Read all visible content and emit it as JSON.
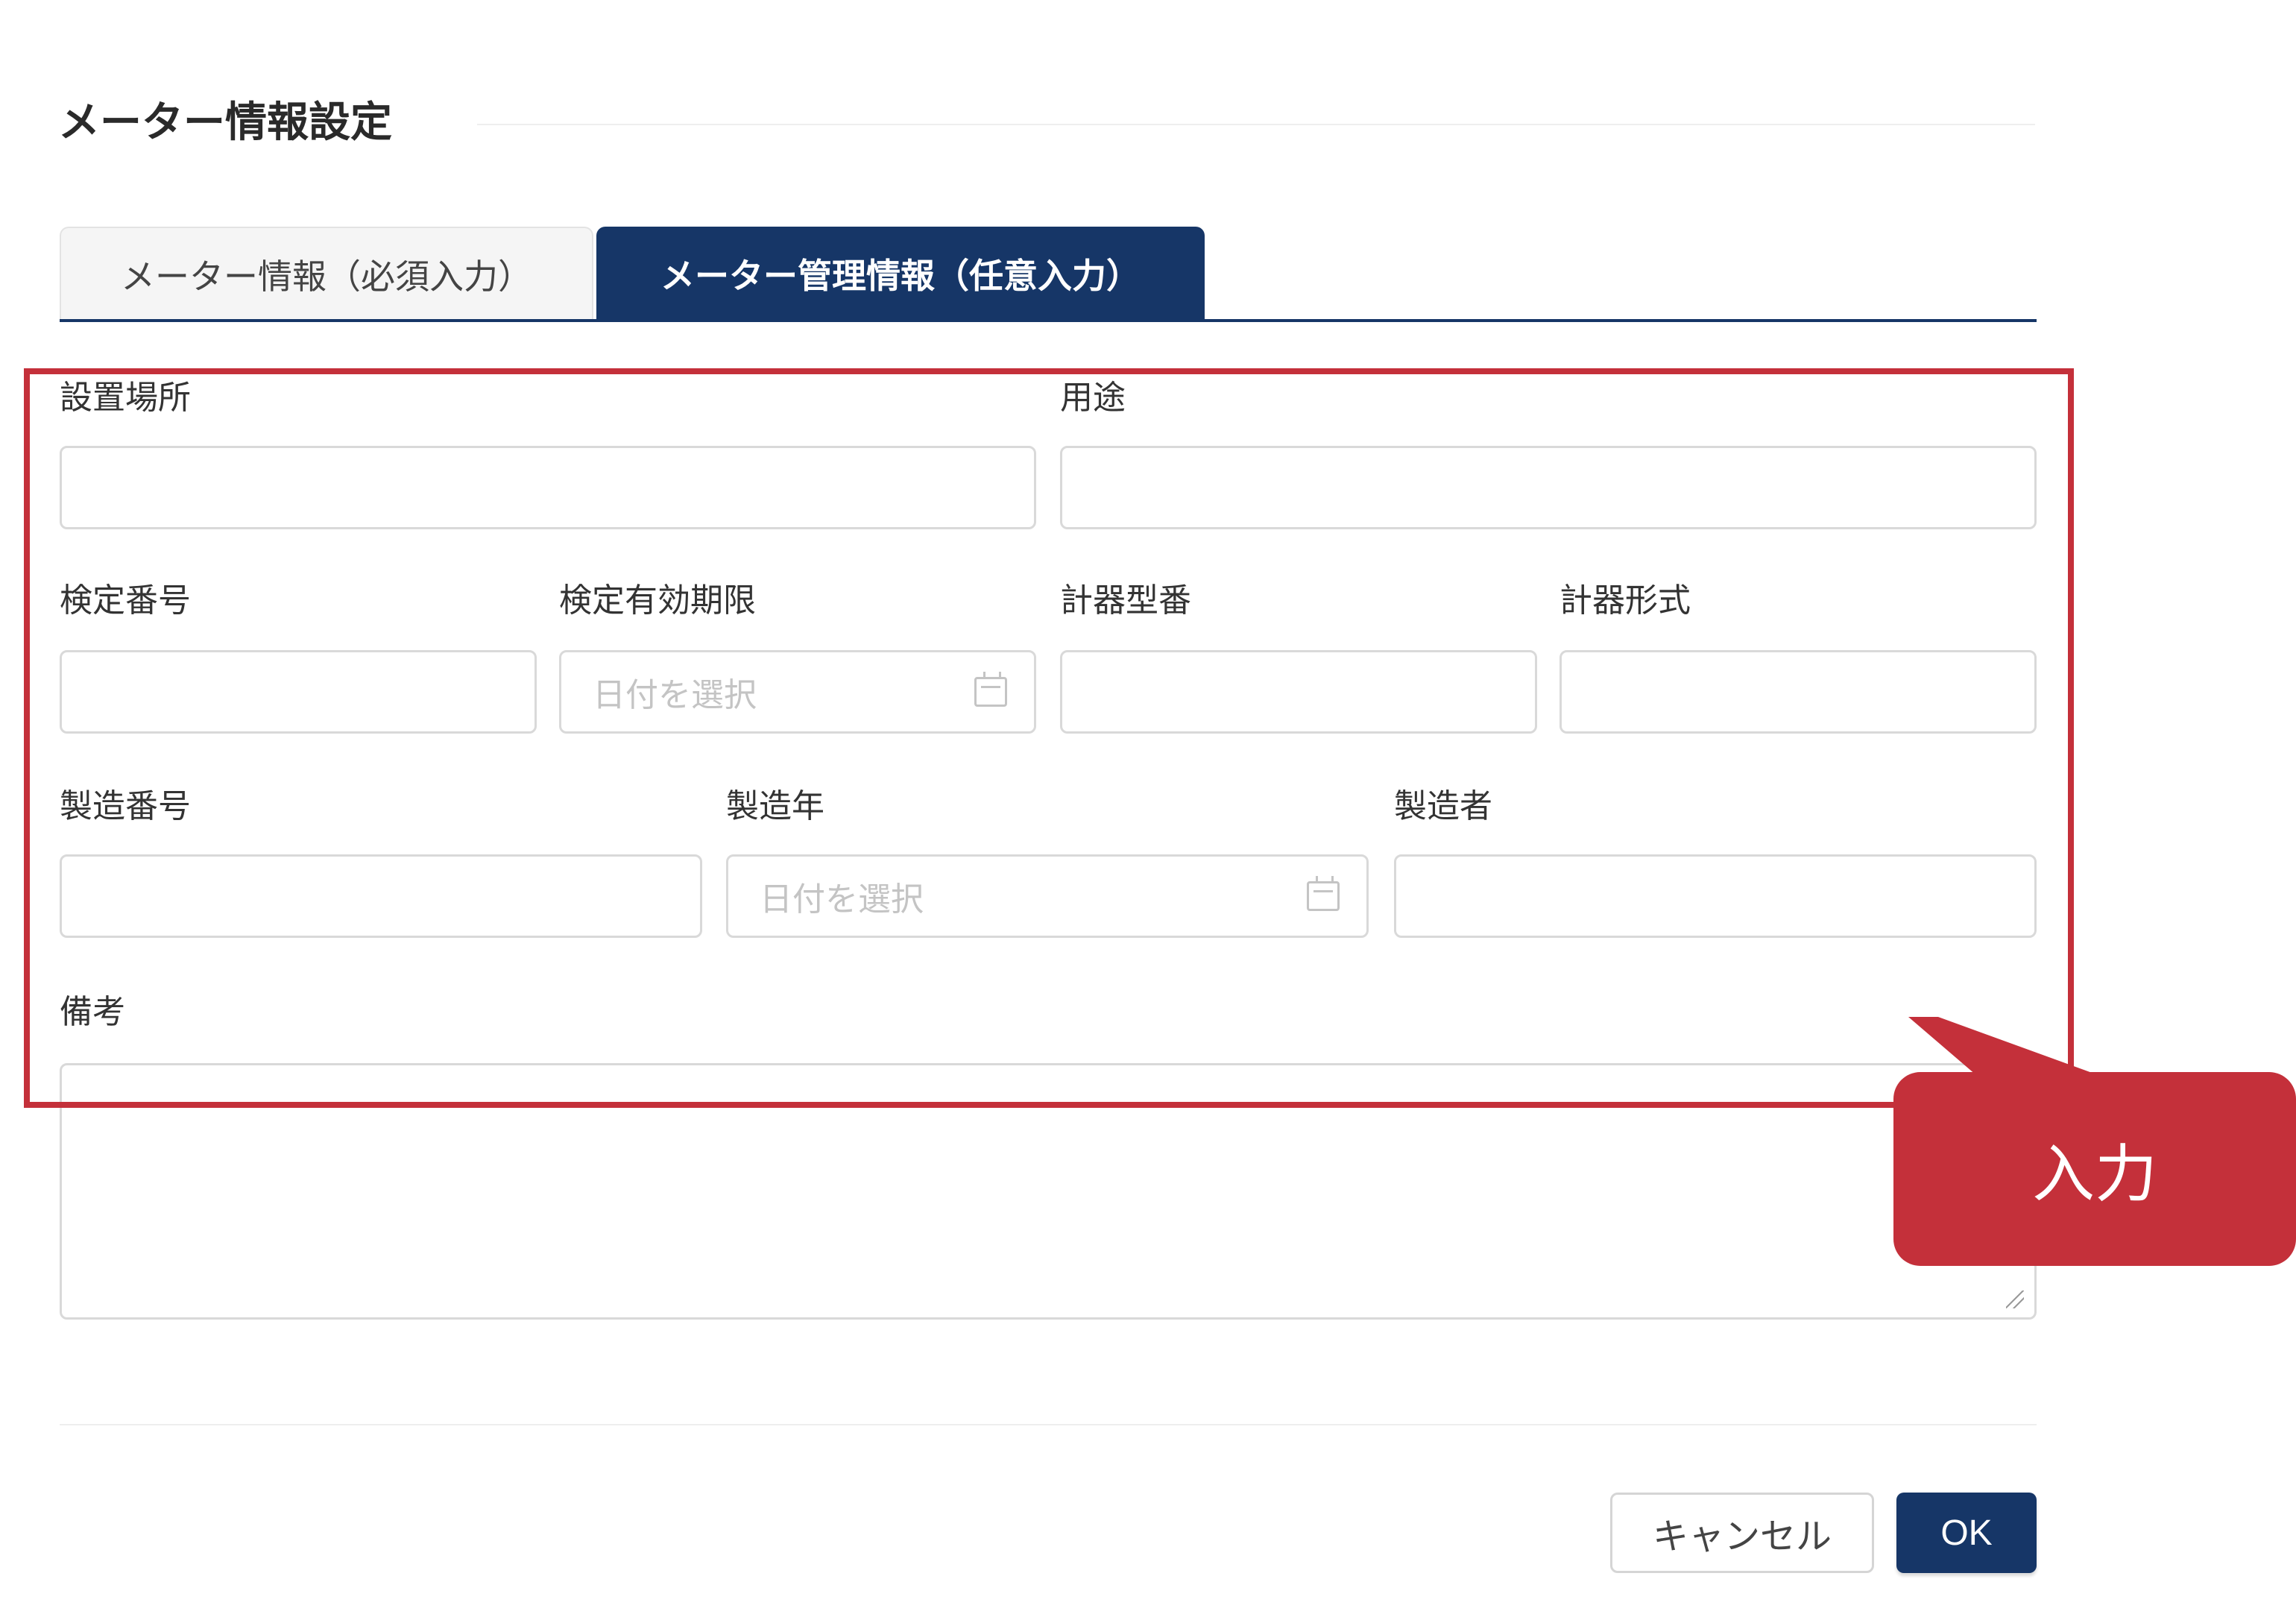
{
  "header": {
    "title": "メーター情報設定"
  },
  "tabs": [
    {
      "label": "メーター情報（必須入力）",
      "active": false
    },
    {
      "label": "メーター管理情報（任意入力）",
      "active": true
    }
  ],
  "form": {
    "installation_location": {
      "label": "設置場所",
      "value": ""
    },
    "usage": {
      "label": "用途",
      "value": ""
    },
    "verification_number": {
      "label": "検定番号",
      "value": ""
    },
    "verification_expiry": {
      "label": "検定有効期限",
      "placeholder": "日付を選択"
    },
    "instrument_model_number": {
      "label": "計器型番",
      "value": ""
    },
    "instrument_type": {
      "label": "計器形式",
      "value": ""
    },
    "manufacturing_number": {
      "label": "製造番号",
      "value": ""
    },
    "manufacturing_year": {
      "label": "製造年",
      "placeholder": "日付を選択"
    },
    "manufacturer": {
      "label": "製造者",
      "value": ""
    },
    "remarks": {
      "label": "備考",
      "value": ""
    }
  },
  "footer": {
    "cancel_label": "キャンセル",
    "ok_label": "OK"
  },
  "annotation": {
    "callout_text": "入力"
  },
  "colors": {
    "primary": "#163667",
    "annotation": "#c4303a",
    "border": "#d9d9d9",
    "placeholder": "#c4c4c4"
  },
  "icons": {
    "date_picker": "calendar-icon",
    "textarea_resize": "resize-handle-icon"
  }
}
